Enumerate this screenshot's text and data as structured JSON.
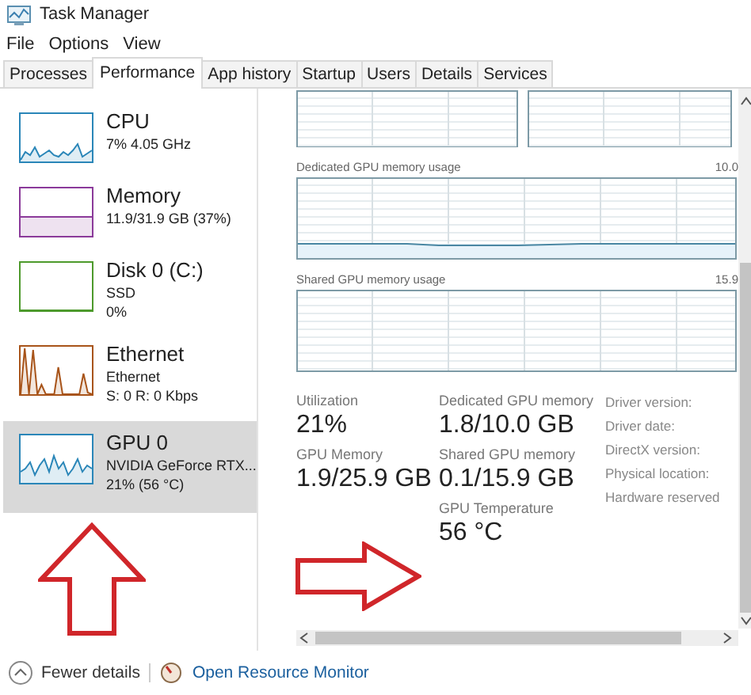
{
  "window": {
    "title": "Task Manager"
  },
  "menu": [
    "File",
    "Options",
    "View"
  ],
  "tabs": [
    {
      "label": "Processes",
      "selected": false
    },
    {
      "label": "Performance",
      "selected": true
    },
    {
      "label": "App history",
      "selected": false
    },
    {
      "label": "Startup",
      "selected": false
    },
    {
      "label": "Users",
      "selected": false
    },
    {
      "label": "Details",
      "selected": false
    },
    {
      "label": "Services",
      "selected": false
    }
  ],
  "sidebar": {
    "items": [
      {
        "name": "CPU",
        "lines": [
          "7% 4.05 GHz"
        ],
        "color": "#2a86b8",
        "selected": false
      },
      {
        "name": "Memory",
        "lines": [
          "11.9/31.9 GB (37%)"
        ],
        "color": "#8b3a9a",
        "selected": false
      },
      {
        "name": "Disk 0 (C:)",
        "lines": [
          "SSD",
          "0%"
        ],
        "color": "#4d9a2c",
        "selected": false
      },
      {
        "name": "Ethernet",
        "lines": [
          "Ethernet",
          "S: 0 R: 0 Kbps"
        ],
        "color": "#a8541a",
        "selected": false
      },
      {
        "name": "GPU 0",
        "lines": [
          "NVIDIA GeForce RTX...",
          "21% (56 °C)"
        ],
        "color": "#2a86b8",
        "selected": true
      }
    ]
  },
  "graphs": [
    {
      "label": "Dedicated GPU memory usage",
      "max": "10.0"
    },
    {
      "label": "Shared GPU memory usage",
      "max": "15.9"
    }
  ],
  "stats": [
    [
      {
        "label": "Utilization",
        "value": "21%"
      },
      {
        "label": "GPU Memory",
        "value": "1.9/25.9 GB"
      }
    ],
    [
      {
        "label": "Dedicated GPU memory",
        "value": "1.8/10.0 GB"
      },
      {
        "label": "Shared GPU memory",
        "value": "0.1/15.9 GB"
      },
      {
        "label": "GPU Temperature",
        "value": "56 °C"
      }
    ]
  ],
  "properties": [
    "Driver version:",
    "Driver date:",
    "DirectX version:",
    "Physical location:",
    "Hardware reserved"
  ],
  "footer": {
    "fewer_details": "Fewer details",
    "resource_monitor": "Open Resource Monitor"
  }
}
